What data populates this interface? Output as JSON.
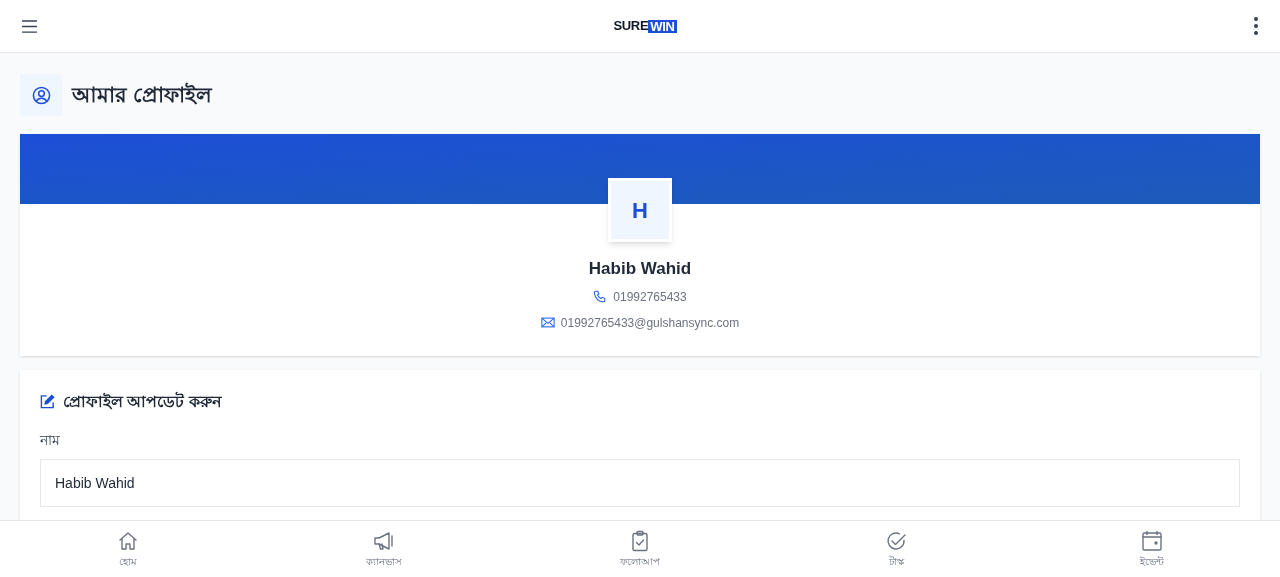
{
  "header": {
    "logo": {
      "first": "SURE",
      "second": "WIN"
    }
  },
  "page_title": "আমার প্রোফাইল",
  "profile": {
    "initial": "H",
    "name": "Habib Wahid",
    "phone": "01992765433",
    "email": "01992765433@gulshansync.com"
  },
  "update_form": {
    "title": "প্রোফাইল আপডেট করুন",
    "fields": [
      {
        "label": "নাম",
        "value": "Habib Wahid"
      }
    ]
  },
  "bottom_nav": [
    {
      "kind": "home",
      "label": "হোম"
    },
    {
      "kind": "megaphone",
      "label": "ক্যানভাস"
    },
    {
      "kind": "clipboard",
      "label": "ফলোআপ"
    },
    {
      "kind": "check",
      "label": "টাস্ক"
    },
    {
      "kind": "calendar",
      "label": "ইভেন্ট"
    }
  ]
}
